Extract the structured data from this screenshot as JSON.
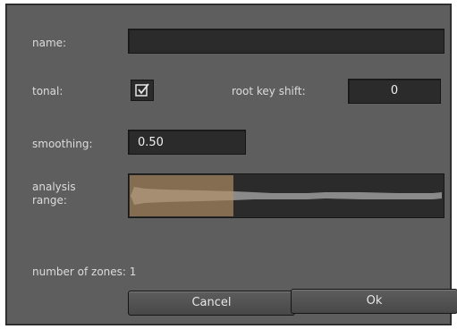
{
  "dialog": {
    "name_label": "name:",
    "name_value": "",
    "tonal_label": "tonal:",
    "tonal_checked": true,
    "root_key_shift_label": "root key shift:",
    "root_key_shift_value": "0",
    "smoothing_label": "smoothing:",
    "smoothing_value": "0.50",
    "analysis_range_label_line1": "analysis",
    "analysis_range_label_line2": "range:",
    "analysis_selection_fraction": 0.33,
    "zones_text": "number of zones: 1",
    "cancel_label": "Cancel",
    "ok_label": "Ok",
    "colors": {
      "panel": "#5e5e5e",
      "field": "#2b2b2b",
      "selection": "#b49066",
      "waveform": "#8a8a8a"
    }
  }
}
